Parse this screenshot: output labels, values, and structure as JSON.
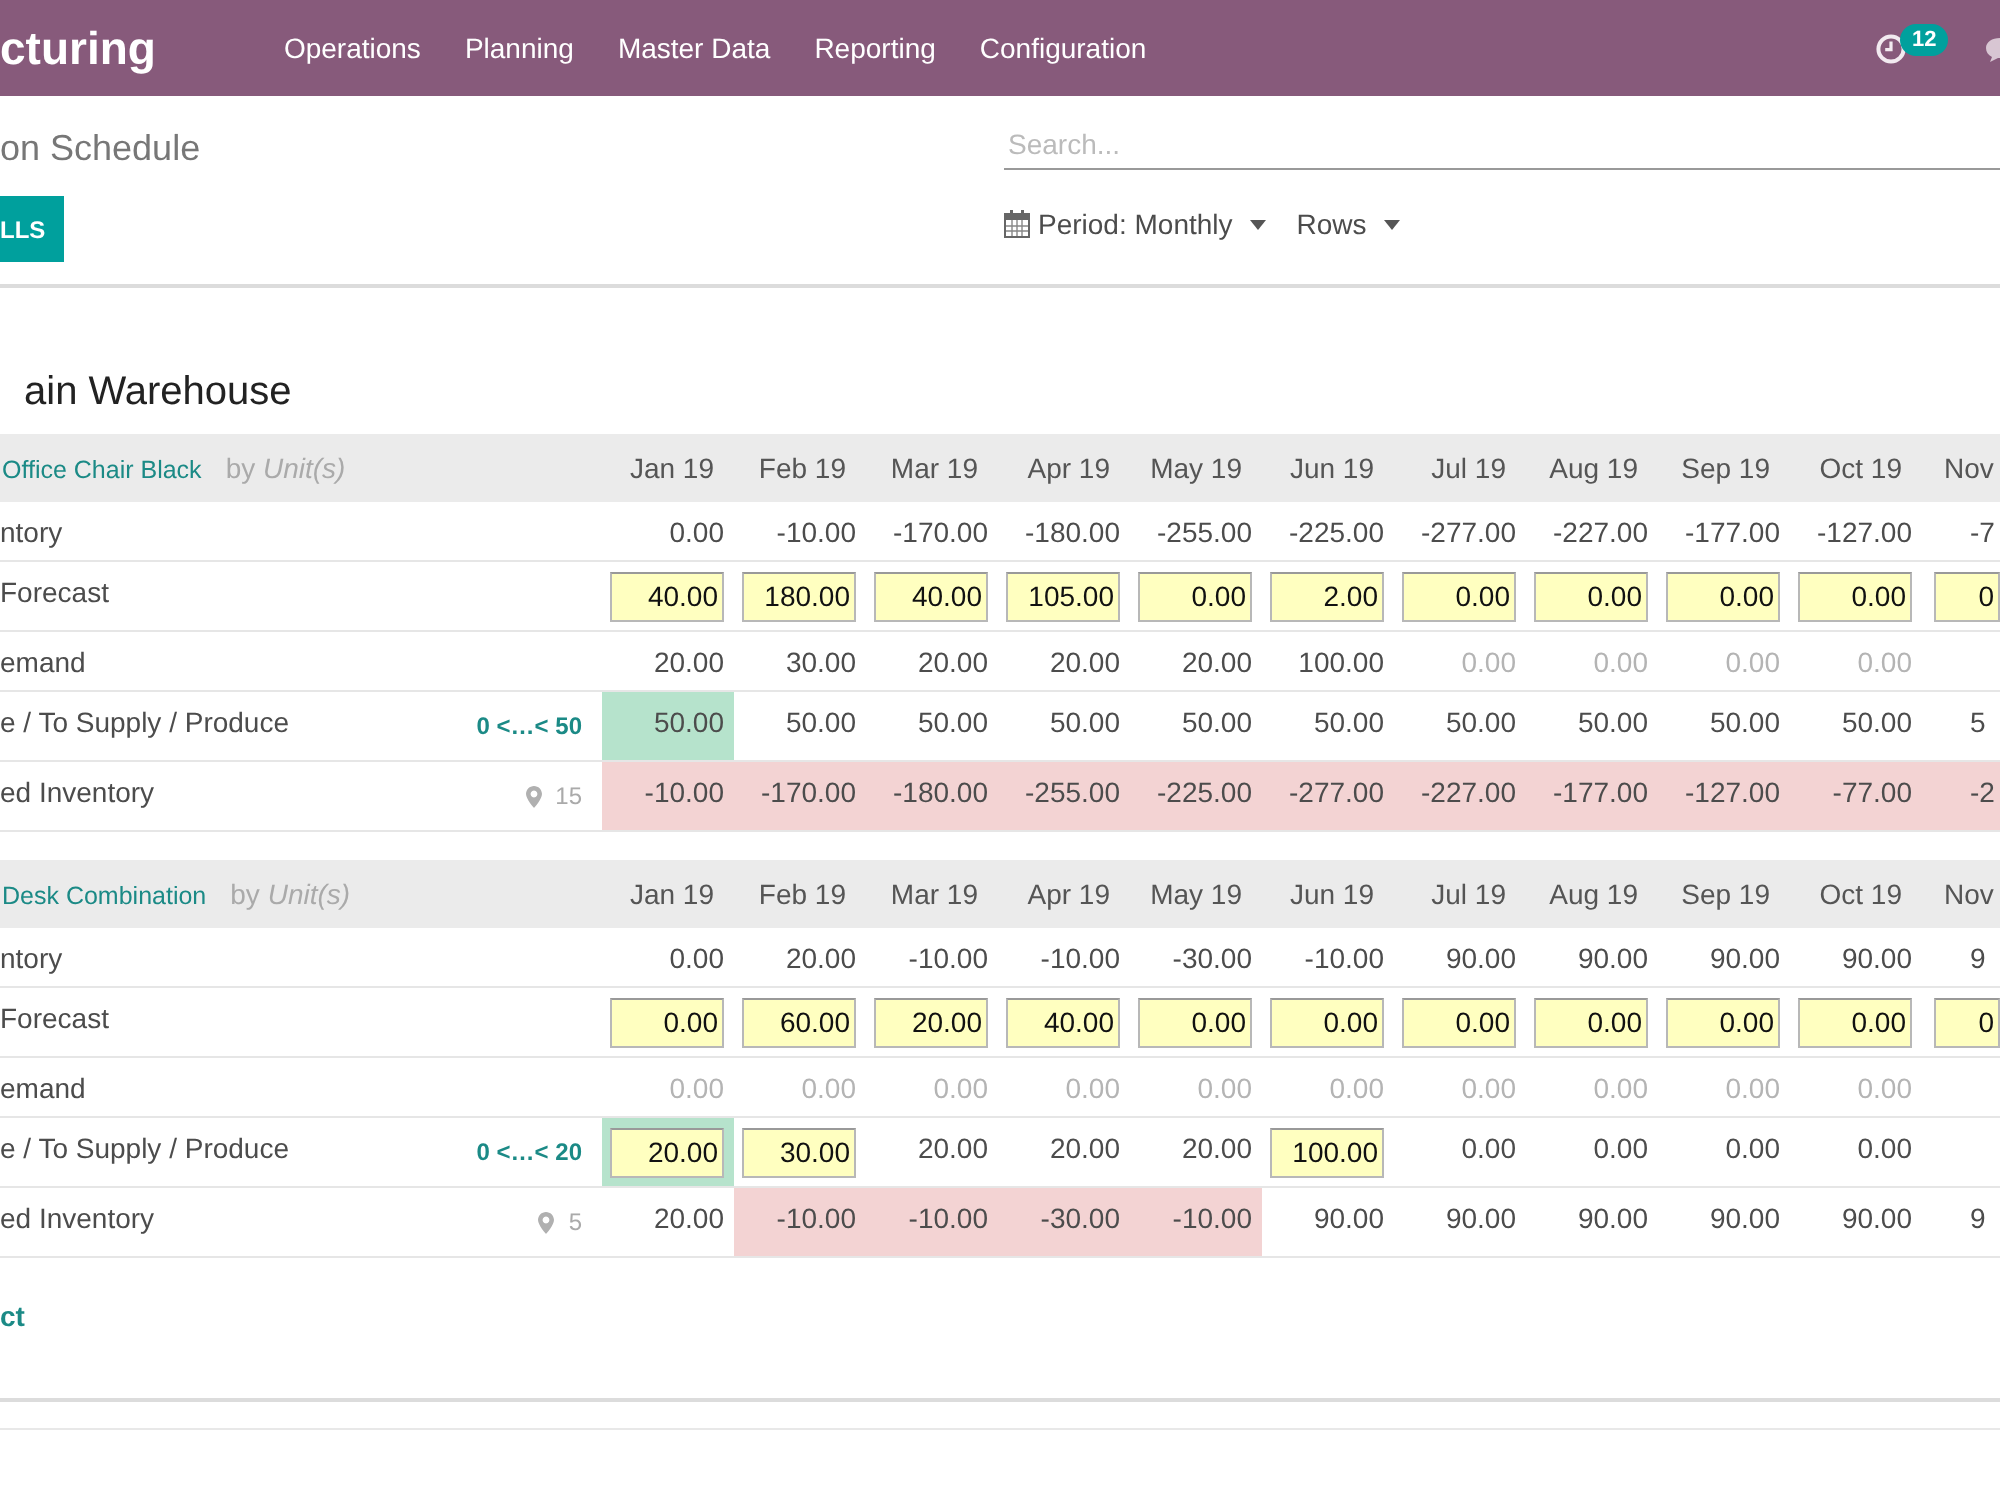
{
  "navbar": {
    "brand": "cturing",
    "menu": [
      "Operations",
      "Planning",
      "Master Data",
      "Reporting",
      "Configuration"
    ],
    "activity_count": "12"
  },
  "control_panel": {
    "title": "on Schedule",
    "button": "LLS",
    "search": {
      "placeholder": "Search..."
    },
    "filters": [
      {
        "label": "Period: Monthly",
        "kind": "period"
      },
      {
        "label": "Rows",
        "kind": "group"
      }
    ]
  },
  "warehouse": "ain Warehouse",
  "products": [
    {
      "name": "Office Chair Black",
      "uom": "by *Unit(s)*",
      "months": [
        "Jan 19",
        "Feb 19",
        "Mar 19",
        "Apr 19",
        "May 19",
        "Jun 19",
        "Jul 19",
        "Aug 19",
        "Sep 19",
        "Oct 19",
        "Nov"
      ],
      "rows": [
        {
          "label": "ntory",
          "cells": [
            {
              "value": "0.00",
              "kind": "text",
              "muted": false
            },
            {
              "value": "-10.00",
              "kind": "text",
              "muted": false
            },
            {
              "value": "-170.00",
              "kind": "text",
              "muted": false
            },
            {
              "value": "-180.00",
              "kind": "text",
              "muted": false
            },
            {
              "value": "-255.00",
              "kind": "text",
              "muted": false
            },
            {
              "value": "-225.00",
              "kind": "text",
              "muted": false
            },
            {
              "value": "-277.00",
              "kind": "text",
              "muted": false
            },
            {
              "value": "-227.00",
              "kind": "text",
              "muted": false
            },
            {
              "value": "-177.00",
              "kind": "text",
              "muted": false
            },
            {
              "value": "-127.00",
              "kind": "text",
              "muted": false
            },
            {
              "value": "-7",
              "kind": "text",
              "muted": false
            }
          ]
        },
        {
          "label": "Forecast",
          "cells": [
            {
              "value": "40.00",
              "kind": "input",
              "muted": false
            },
            {
              "value": "180.00",
              "kind": "input",
              "muted": false
            },
            {
              "value": "40.00",
              "kind": "input",
              "muted": false
            },
            {
              "value": "105.00",
              "kind": "input",
              "muted": false
            },
            {
              "value": "0.00",
              "kind": "input",
              "muted": false
            },
            {
              "value": "2.00",
              "kind": "input",
              "muted": false
            },
            {
              "value": "0.00",
              "kind": "input",
              "muted": false
            },
            {
              "value": "0.00",
              "kind": "input",
              "muted": false
            },
            {
              "value": "0.00",
              "kind": "input",
              "muted": false
            },
            {
              "value": "0.00",
              "kind": "input",
              "muted": false
            },
            {
              "value": "0",
              "kind": "input",
              "muted": false
            }
          ]
        },
        {
          "label": "emand",
          "cells": [
            {
              "value": "20.00",
              "kind": "text",
              "muted": false
            },
            {
              "value": "30.00",
              "kind": "text",
              "muted": false
            },
            {
              "value": "20.00",
              "kind": "text",
              "muted": false
            },
            {
              "value": "20.00",
              "kind": "text",
              "muted": false
            },
            {
              "value": "20.00",
              "kind": "text",
              "muted": false
            },
            {
              "value": "100.00",
              "kind": "text",
              "muted": false
            },
            {
              "value": "0.00",
              "kind": "text",
              "muted": true
            },
            {
              "value": "0.00",
              "kind": "text",
              "muted": true
            },
            {
              "value": "0.00",
              "kind": "text",
              "muted": true
            },
            {
              "value": "0.00",
              "kind": "text",
              "muted": true
            }
          ]
        },
        {
          "label": "e / To Supply / Produce",
          "range": "0 <…< 50",
          "cells": [
            {
              "value": "50.00",
              "kind": "text",
              "muted": false,
              "color": "#b6e3cc"
            },
            {
              "value": "50.00",
              "kind": "text",
              "muted": false
            },
            {
              "value": "50.00",
              "kind": "text",
              "muted": false
            },
            {
              "value": "50.00",
              "kind": "text",
              "muted": false
            },
            {
              "value": "50.00",
              "kind": "text",
              "muted": false
            },
            {
              "value": "50.00",
              "kind": "text",
              "muted": false
            },
            {
              "value": "50.00",
              "kind": "text",
              "muted": false
            },
            {
              "value": "50.00",
              "kind": "text",
              "muted": false
            },
            {
              "value": "50.00",
              "kind": "text",
              "muted": false
            },
            {
              "value": "50.00",
              "kind": "text",
              "muted": false
            },
            {
              "value": "5",
              "kind": "text",
              "muted": false
            }
          ]
        },
        {
          "label": "ed Inventory",
          "safety_stock": "15",
          "cells": [
            {
              "value": "-10.00",
              "kind": "text",
              "muted": false,
              "color": "#f3d3d3"
            },
            {
              "value": "-170.00",
              "kind": "text",
              "muted": false,
              "color": "#f3d3d3"
            },
            {
              "value": "-180.00",
              "kind": "text",
              "muted": false,
              "color": "#f3d3d3"
            },
            {
              "value": "-255.00",
              "kind": "text",
              "muted": false,
              "color": "#f3d3d3"
            },
            {
              "value": "-225.00",
              "kind": "text",
              "muted": false,
              "color": "#f3d3d3"
            },
            {
              "value": "-277.00",
              "kind": "text",
              "muted": false,
              "color": "#f3d3d3"
            },
            {
              "value": "-227.00",
              "kind": "text",
              "muted": false,
              "color": "#f3d3d3"
            },
            {
              "value": "-177.00",
              "kind": "text",
              "muted": false,
              "color": "#f3d3d3"
            },
            {
              "value": "-127.00",
              "kind": "text",
              "muted": false,
              "color": "#f3d3d3"
            },
            {
              "value": "-77.00",
              "kind": "text",
              "muted": false,
              "color": "#f3d3d3"
            },
            {
              "value": "-2",
              "kind": "text",
              "muted": false,
              "color": "#f3d3d3"
            }
          ]
        }
      ]
    },
    {
      "name": "Desk Combination",
      "uom": "by *Unit(s)*",
      "months": [
        "Jan 19",
        "Feb 19",
        "Mar 19",
        "Apr 19",
        "May 19",
        "Jun 19",
        "Jul 19",
        "Aug 19",
        "Sep 19",
        "Oct 19",
        "Nov"
      ],
      "rows": [
        {
          "label": "ntory",
          "cells": [
            {
              "value": "0.00",
              "kind": "text",
              "muted": false
            },
            {
              "value": "20.00",
              "kind": "text",
              "muted": false
            },
            {
              "value": "-10.00",
              "kind": "text",
              "muted": false
            },
            {
              "value": "-10.00",
              "kind": "text",
              "muted": false
            },
            {
              "value": "-30.00",
              "kind": "text",
              "muted": false
            },
            {
              "value": "-10.00",
              "kind": "text",
              "muted": false
            },
            {
              "value": "90.00",
              "kind": "text",
              "muted": false
            },
            {
              "value": "90.00",
              "kind": "text",
              "muted": false
            },
            {
              "value": "90.00",
              "kind": "text",
              "muted": false
            },
            {
              "value": "90.00",
              "kind": "text",
              "muted": false
            },
            {
              "value": "9",
              "kind": "text",
              "muted": false
            }
          ]
        },
        {
          "label": "Forecast",
          "cells": [
            {
              "value": "0.00",
              "kind": "input",
              "muted": false
            },
            {
              "value": "60.00",
              "kind": "input",
              "muted": false
            },
            {
              "value": "20.00",
              "kind": "input",
              "muted": false
            },
            {
              "value": "40.00",
              "kind": "input",
              "muted": false
            },
            {
              "value": "0.00",
              "kind": "input",
              "muted": false
            },
            {
              "value": "0.00",
              "kind": "input",
              "muted": false
            },
            {
              "value": "0.00",
              "kind": "input",
              "muted": false
            },
            {
              "value": "0.00",
              "kind": "input",
              "muted": false
            },
            {
              "value": "0.00",
              "kind": "input",
              "muted": false
            },
            {
              "value": "0.00",
              "kind": "input",
              "muted": false
            },
            {
              "value": "0",
              "kind": "input",
              "muted": false
            }
          ]
        },
        {
          "label": "emand",
          "cells": [
            {
              "value": "0.00",
              "kind": "text",
              "muted": true
            },
            {
              "value": "0.00",
              "kind": "text",
              "muted": true
            },
            {
              "value": "0.00",
              "kind": "text",
              "muted": true
            },
            {
              "value": "0.00",
              "kind": "text",
              "muted": true
            },
            {
              "value": "0.00",
              "kind": "text",
              "muted": true
            },
            {
              "value": "0.00",
              "kind": "text",
              "muted": true
            },
            {
              "value": "0.00",
              "kind": "text",
              "muted": true
            },
            {
              "value": "0.00",
              "kind": "text",
              "muted": true
            },
            {
              "value": "0.00",
              "kind": "text",
              "muted": true
            },
            {
              "value": "0.00",
              "kind": "text",
              "muted": true
            }
          ]
        },
        {
          "label": "e / To Supply / Produce",
          "range": "0 <…< 20",
          "cells": [
            {
              "value": "20.00",
              "kind": "input",
              "muted": false,
              "color": "#b6e3cc"
            },
            {
              "value": "30.00",
              "kind": "input",
              "muted": false
            },
            {
              "value": "20.00",
              "kind": "text",
              "muted": false
            },
            {
              "value": "20.00",
              "kind": "text",
              "muted": false
            },
            {
              "value": "20.00",
              "kind": "text",
              "muted": false
            },
            {
              "value": "100.00",
              "kind": "input",
              "muted": false
            },
            {
              "value": "0.00",
              "kind": "text",
              "muted": false
            },
            {
              "value": "0.00",
              "kind": "text",
              "muted": false
            },
            {
              "value": "0.00",
              "kind": "text",
              "muted": false
            },
            {
              "value": "0.00",
              "kind": "text",
              "muted": false
            }
          ]
        },
        {
          "label": "ed Inventory",
          "safety_stock": "5",
          "cells": [
            {
              "value": "20.00",
              "kind": "text",
              "muted": false
            },
            {
              "value": "-10.00",
              "kind": "text",
              "muted": false,
              "color": "#f3d3d3"
            },
            {
              "value": "-10.00",
              "kind": "text",
              "muted": false,
              "color": "#f3d3d3"
            },
            {
              "value": "-30.00",
              "kind": "text",
              "muted": false,
              "color": "#f3d3d3"
            },
            {
              "value": "-10.00",
              "kind": "text",
              "muted": false,
              "color": "#f3d3d3"
            },
            {
              "value": "90.00",
              "kind": "text",
              "muted": false
            },
            {
              "value": "90.00",
              "kind": "text",
              "muted": false
            },
            {
              "value": "90.00",
              "kind": "text",
              "muted": false
            },
            {
              "value": "90.00",
              "kind": "text",
              "muted": false
            },
            {
              "value": "90.00",
              "kind": "text",
              "muted": false
            },
            {
              "value": "9",
              "kind": "text",
              "muted": false
            }
          ]
        }
      ]
    }
  ],
  "add_product": "ct"
}
